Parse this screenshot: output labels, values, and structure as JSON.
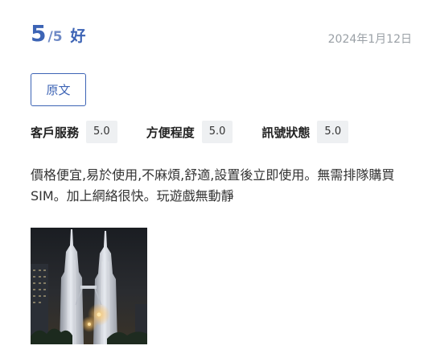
{
  "review": {
    "score": "5",
    "score_max": "5",
    "score_sep": "/",
    "score_word": "好",
    "date": "2024年1月12日",
    "original_button_label": "原文",
    "ratings": [
      {
        "label": "客戶服務",
        "value": "5.0"
      },
      {
        "label": "方便程度",
        "value": "5.0"
      },
      {
        "label": "訊號狀態",
        "value": "5.0"
      }
    ],
    "text": "價格便宜,易於使用,不麻煩,舒適,設置後立即使用。無需排隊購買SIM。加上網絡很快。玩遊戲無動靜",
    "photo_icon": "petronas-towers-night-photo"
  },
  "colors": {
    "accent": "#3d64b5",
    "date_gray": "#9aa0a6",
    "badge_bg": "#eef0f2",
    "text": "#333333"
  }
}
